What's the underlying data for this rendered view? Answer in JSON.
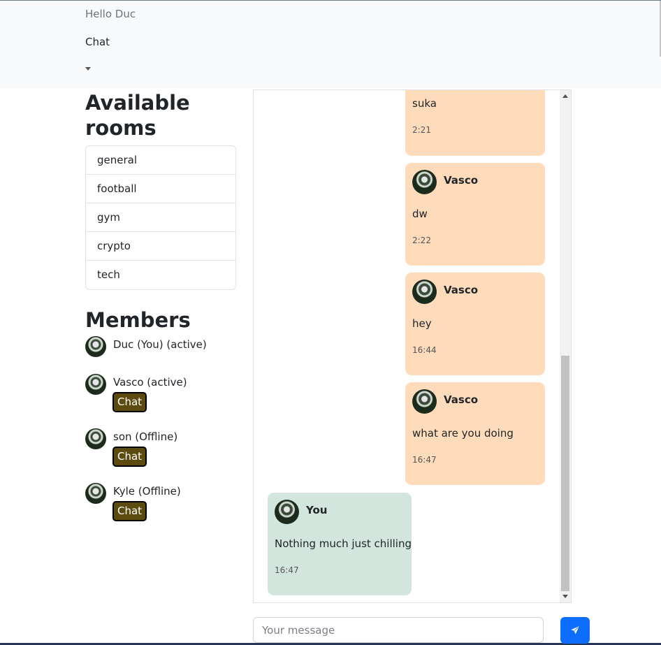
{
  "navbar": {
    "brand": "Hello Duc",
    "chat_link": "Chat"
  },
  "sidebar": {
    "rooms_title": "Available rooms",
    "rooms": [
      "general",
      "football",
      "gym",
      "crypto",
      "tech"
    ],
    "members_title": "Members",
    "chat_button_label": "Chat",
    "members": [
      {
        "name": "Duc (You) (active)",
        "has_chat": false
      },
      {
        "name": "Vasco (active)",
        "has_chat": true
      },
      {
        "name": "son (Offline)",
        "has_chat": true
      },
      {
        "name": "Kyle (Offline)",
        "has_chat": true
      }
    ]
  },
  "messages": [
    {
      "author": "",
      "text": "suka",
      "time": "2:21",
      "mine": false
    },
    {
      "author": "Vasco",
      "text": "dw",
      "time": "2:22",
      "mine": false
    },
    {
      "author": "Vasco",
      "text": "hey",
      "time": "16:44",
      "mine": false
    },
    {
      "author": "Vasco",
      "text": "what are you doing",
      "time": "16:47",
      "mine": false
    },
    {
      "author": "You",
      "text": "Nothing much just chilling",
      "time": "16:47",
      "mine": true
    }
  ],
  "composer": {
    "placeholder": "Your message",
    "send_icon": "paper-plane-icon"
  },
  "colors": {
    "other_bubble": "#fddbbb",
    "my_bubble": "#d2e6dd",
    "chat_button": "#5c4a0f",
    "send_button": "#0d6efd"
  }
}
